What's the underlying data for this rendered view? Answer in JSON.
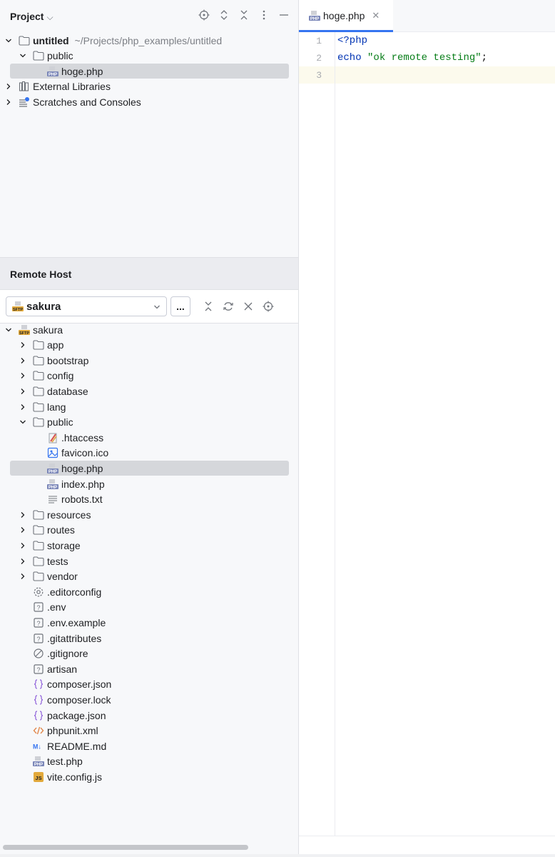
{
  "project_panel": {
    "title": "Project",
    "tree": [
      {
        "label": "untitled",
        "path": "~/Projects/php_examples/untitled",
        "icon": "folder-icon"
      },
      {
        "label": "public",
        "icon": "folder-icon"
      },
      {
        "label": "hoge.php",
        "icon": "php-file-icon",
        "selected": true
      },
      {
        "label": "External Libraries",
        "icon": "library-icon"
      },
      {
        "label": "Scratches and Consoles",
        "icon": "scratches-icon"
      }
    ]
  },
  "remote_host": {
    "title": "Remote Host",
    "server": "sakura",
    "more_label": "...",
    "tree": {
      "root": "sakura",
      "dirs_top": [
        "app",
        "bootstrap",
        "config",
        "database",
        "lang"
      ],
      "public": "public",
      "public_files": [
        ".htaccess",
        "favicon.ico",
        "hoge.php",
        "index.php",
        "robots.txt"
      ],
      "dirs_bottom": [
        "resources",
        "routes",
        "storage",
        "tests",
        "vendor"
      ],
      "files": [
        ".editorconfig",
        ".env",
        ".env.example",
        ".gitattributes",
        ".gitignore",
        "artisan",
        "composer.json",
        "composer.lock",
        "package.json",
        "phpunit.xml",
        "README.md",
        "test.php",
        "vite.config.js"
      ]
    }
  },
  "editor": {
    "tab_label": "hoge.php",
    "line_numbers": [
      "1",
      "2",
      "3"
    ],
    "lines": {
      "l1": "<?php",
      "l2_kw": "echo",
      "l2_str": "\"ok remote testing\"",
      "l2_end": ";"
    }
  },
  "colors": {
    "accent": "#3574f0",
    "selection": "#d5d7db",
    "keyword": "#0033b3",
    "string": "#067d17"
  }
}
